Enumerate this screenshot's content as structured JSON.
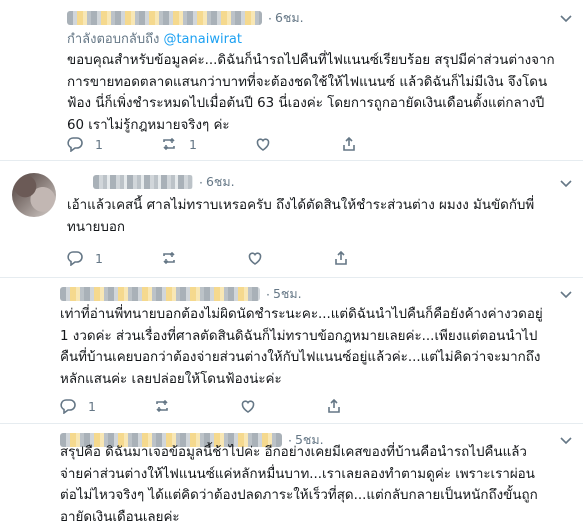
{
  "tweets": [
    {
      "time": "6ชม.",
      "replying_prefix": "กำลังตอบกลับถึง",
      "replying_handle": "@tanaiwirat",
      "lines": [
        "ขอบคุณสำหรับข้อมูลค่ะ...ดิฉันก็นำรถไปคืนที่ไฟแนนซ์เรียบร้อย สรุปมีค่าส่วนต่างจาก",
        "การขายทอดตลาดแสนกว่าบาทที่จะต้องชดใช้ให้ไฟแนนซ์ แล้วดิฉันก็ไม่มีเงิน จึงโดน",
        "ฟ้อง นี่ก็เพิ่งชำระหมดไปเมื่อต้นปี 63 นี่เองค่ะ โดยการถูกอายัดเงินเดือนตั้งแต่กลางปี",
        "60 เราไม่รู้กฎหมายจริงๆ ค่ะ"
      ],
      "reply_count": "1",
      "retweet_count": "1",
      "like_count": ""
    },
    {
      "time": "6ชม.",
      "lines": [
        "เอ้าแล้วเคสนี้ ศาลไม่ทราบเหรอครับ ถึงได้ตัดสินให้ชำระส่วนต่าง ผมงง มันขัดกับพี่",
        "ทนายบอก"
      ],
      "reply_count": "1",
      "retweet_count": "",
      "like_count": ""
    },
    {
      "time": "5ชม.",
      "lines": [
        "เท่าที่อ่านพี่ทนายบอกต้องไม่ผิดนัดชำระนะคะ...แต่ดิฉันนำไปคืนก็คือยังค้างค่างวดอยู่",
        "1 งวดค่ะ ส่วนเรื่องที่ศาลตัดสินดิฉันก็ไม่ทราบข้อกฎหมายเลยค่ะ...เพียงแต่ตอนนำไป",
        "คืนที่บ้านเคยบอกว่าต้องจ่ายส่วนต่างให้กับไฟแนนซ์อยู่แล้วค่ะ...แต่ไม่คิดว่าจะมากถึง",
        "หลักแสนค่ะ เลยปล่อยให้โดนฟ้องน่ะค่ะ"
      ],
      "reply_count": "1",
      "retweet_count": "",
      "like_count": ""
    },
    {
      "time": "5ชม.",
      "lines": [
        "สรุปคือ ดิฉันมาเจอข้อมูลนี้ช้าไปค่ะ อีกอย่างเคยมีเคสของที่บ้านคือนำรถไปคืนแล้ว",
        "จ่ายค่าส่วนต่างให้ไฟแนนซ์แค่หลักหมื่นบาท...เราเลยลองทำตามดูค่ะ เพราะเราผ่อน",
        "ต่อไม่ไหวจริงๆ ได้แต่คิดว่าต้องปลดภาระให้เร็วที่สุด...แต่กลับกลายเป็นหนักถึงขั้นถูก",
        "อายัดเงินเดือนเลยค่ะ"
      ]
    }
  ]
}
